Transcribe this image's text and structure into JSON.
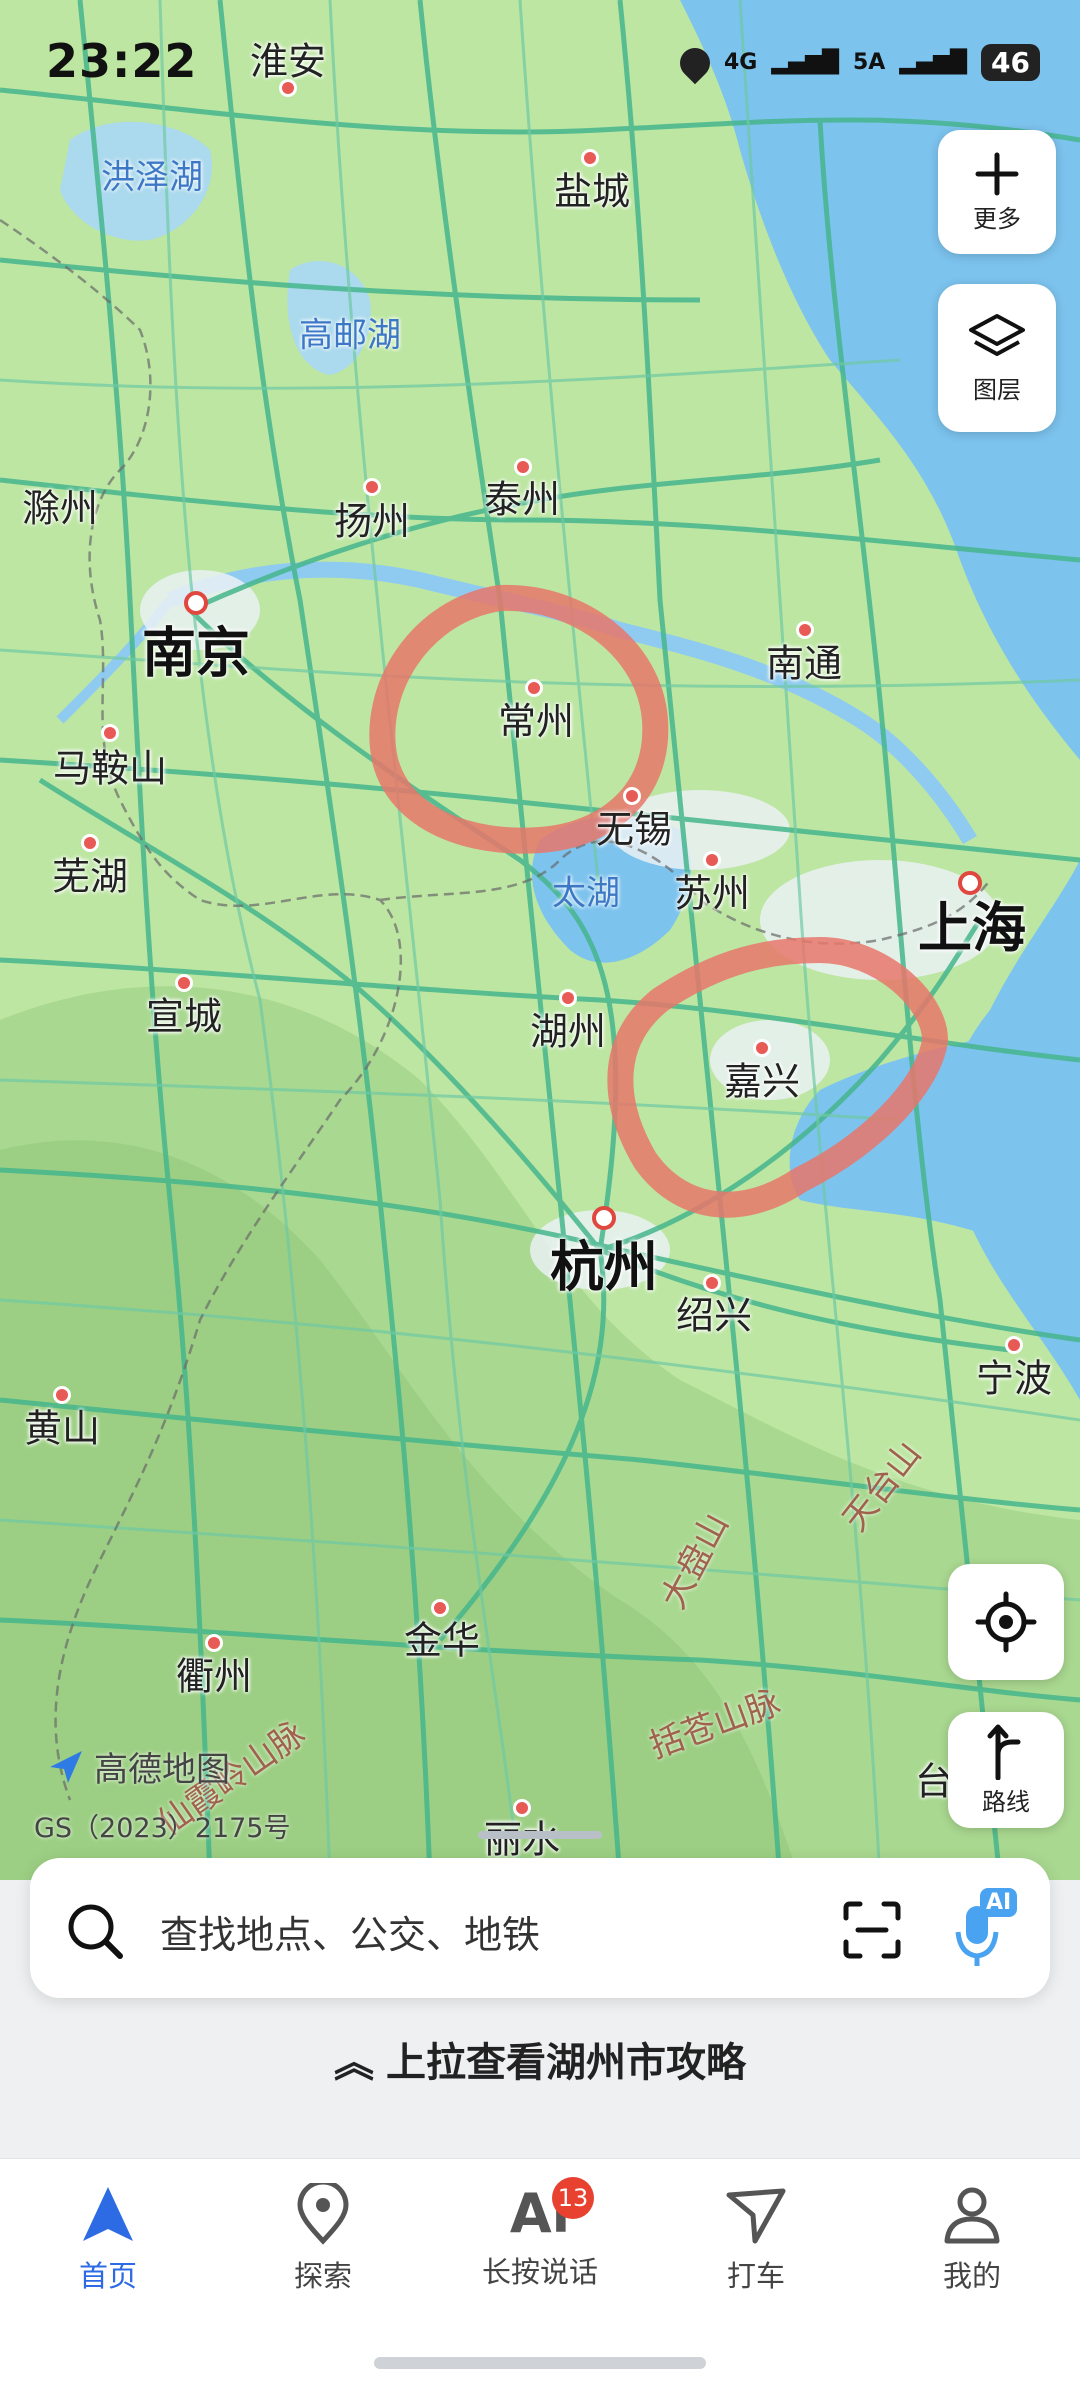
{
  "status_bar": {
    "time": "23:22",
    "net1": "4G",
    "net2": "5A",
    "battery": "46"
  },
  "map": {
    "cities": [
      {
        "name": "淮安",
        "big": false
      },
      {
        "name": "盐城",
        "big": false
      },
      {
        "name": "泰州",
        "big": false
      },
      {
        "name": "扬州",
        "big": false
      },
      {
        "name": "滁州",
        "big": false
      },
      {
        "name": "南京",
        "big": true
      },
      {
        "name": "南通",
        "big": false
      },
      {
        "name": "常州",
        "big": false
      },
      {
        "name": "无锡",
        "big": false
      },
      {
        "name": "马鞍山",
        "big": false
      },
      {
        "name": "芜湖",
        "big": false
      },
      {
        "name": "苏州",
        "big": false
      },
      {
        "name": "上海",
        "big": true
      },
      {
        "name": "湖州",
        "big": false
      },
      {
        "name": "宣城",
        "big": false
      },
      {
        "name": "嘉兴",
        "big": false
      },
      {
        "name": "杭州",
        "big": true
      },
      {
        "name": "绍兴",
        "big": false
      },
      {
        "name": "宁波",
        "big": false
      },
      {
        "name": "黄山",
        "big": false
      },
      {
        "name": "金华",
        "big": false
      },
      {
        "name": "衢州",
        "big": false
      },
      {
        "name": "丽水",
        "big": false
      },
      {
        "name": "台",
        "big": false
      }
    ],
    "lakes": [
      "洪泽湖",
      "高邮湖",
      "太湖"
    ],
    "mountains": [
      "天台山",
      "大盘山",
      "括苍山脉",
      "仙霞岭山脉"
    ],
    "annotation_color": "#e8776b",
    "land_color": "#bde6a2",
    "water_color": "#7cc3ee"
  },
  "controls": {
    "more": "更多",
    "layers": "图层",
    "route": "路线"
  },
  "watermark": {
    "brand": "高德地图",
    "license": "GS（2023）2175号"
  },
  "search": {
    "placeholder": "查找地点、公交、地铁",
    "ai_badge": "AI"
  },
  "pullup_hint": "上拉查看湖州市攻略",
  "tabs": [
    {
      "label": "首页",
      "active": true
    },
    {
      "label": "探索",
      "active": false
    },
    {
      "label": "长按说话",
      "active": false,
      "badge": "13",
      "icon_text": "Ai"
    },
    {
      "label": "打车",
      "active": false
    },
    {
      "label": "我的",
      "active": false
    }
  ]
}
